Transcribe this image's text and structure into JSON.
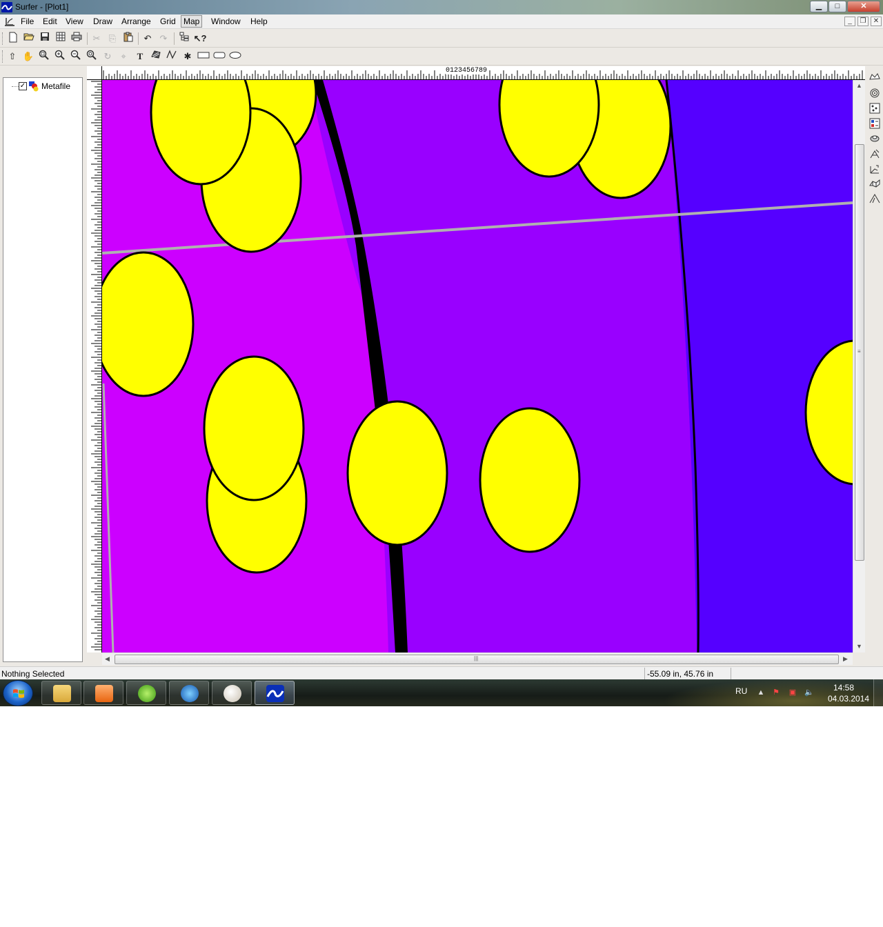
{
  "window": {
    "title": "Surfer - [Plot1]",
    "controls": {
      "minimize": "▁",
      "maximize": "□",
      "close": "✕"
    }
  },
  "menu": {
    "items": [
      "File",
      "Edit",
      "View",
      "Draw",
      "Arrange",
      "Grid",
      "Map",
      "Window",
      "Help"
    ],
    "active": "Map",
    "mdi_controls": {
      "minimize": "_",
      "restore": "❐",
      "close": "✕"
    }
  },
  "toolbar_main": {
    "buttons": [
      "new-icon",
      "open-icon",
      "save-icon",
      "worksheet-icon",
      "print-icon",
      "cut-icon",
      "copy-icon",
      "paste-icon",
      "undo-icon",
      "redo-icon",
      "object-manager-icon",
      "whats-this-icon"
    ]
  },
  "toolbar_draw": {
    "buttons": [
      "select-icon",
      "pan-icon",
      "zoom-rect-icon",
      "zoom-in-icon",
      "zoom-out-icon",
      "zoom-page-icon",
      "rotate-icon",
      "reshape-icon",
      "text-icon",
      "polygon-icon",
      "polyline-icon",
      "symbol-icon",
      "rectangle-icon",
      "rounded-rectangle-icon",
      "ellipse-icon"
    ],
    "text_tool_glyph": "T"
  },
  "object_manager": {
    "item_label": "Metafile",
    "item_checked": true
  },
  "ruler": {
    "label": "0123456789"
  },
  "map_toolbar": {
    "buttons": [
      "new-contour-map-icon",
      "new-base-map-icon",
      "new-post-map-icon",
      "new-image-map-icon",
      "new-shaded-relief-icon",
      "new-vector-map-icon",
      "new-wireframe-icon",
      "new-surface-icon",
      "new-3d-icon"
    ]
  },
  "status": {
    "selection": "Nothing Selected",
    "coordinates": "-55.09 in, 45.76 in"
  },
  "taskbar": {
    "apps": [
      "explorer",
      "media-player",
      "green-app",
      "globe-app",
      "paint",
      "surfer"
    ],
    "active_app": "surfer",
    "language": "RU",
    "time": "14:58",
    "date": "04.03.2014"
  },
  "colors": {
    "magenta": "#cc00ff",
    "purple": "#9900ff",
    "blue_violet": "#5500ff",
    "yellow": "#ffff00",
    "gray_line": "#b0b0b0"
  }
}
